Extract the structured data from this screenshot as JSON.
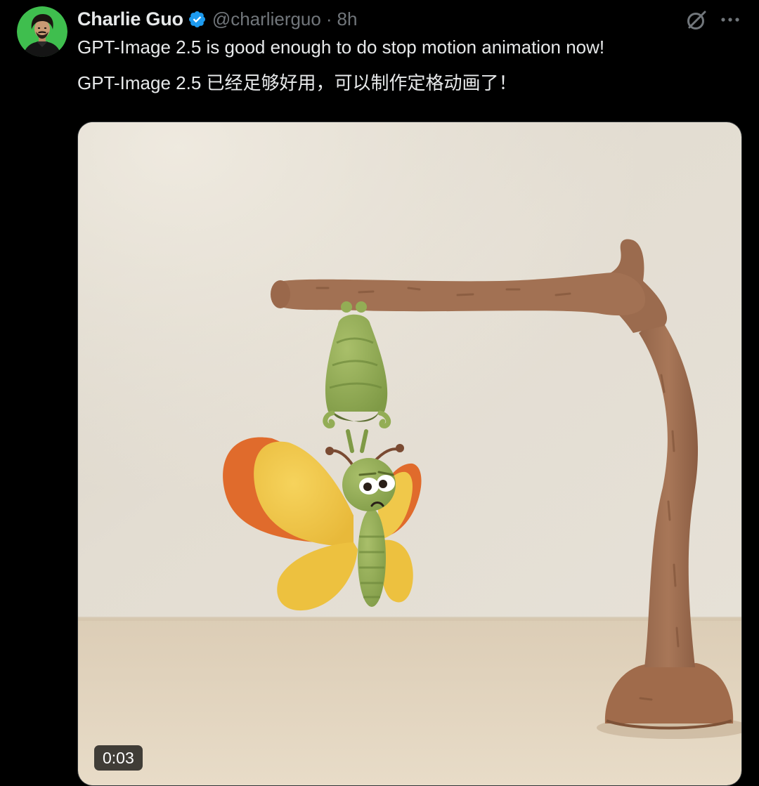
{
  "tweet": {
    "author": {
      "display_name": "Charlie Guo",
      "handle": "@charlierguo",
      "verified": true
    },
    "separator": "·",
    "timestamp": "8h",
    "text_lines": [
      "GPT-Image 2.5 is good enough to do stop motion animation now!",
      "GPT-Image 2.5 已经足够好用，可以制作定格动画了！"
    ],
    "media": {
      "type": "video",
      "duration": "0:03"
    },
    "icons": {
      "verified": "verified-badge-icon",
      "grok": "grok-icon",
      "more": "more-options-icon"
    }
  },
  "colors": {
    "background": "#000000",
    "primary_text": "#e7e9ea",
    "secondary_text": "#71767b",
    "verified_blue": "#1d9bf0",
    "avatar_bg": "#3fbe4e"
  }
}
